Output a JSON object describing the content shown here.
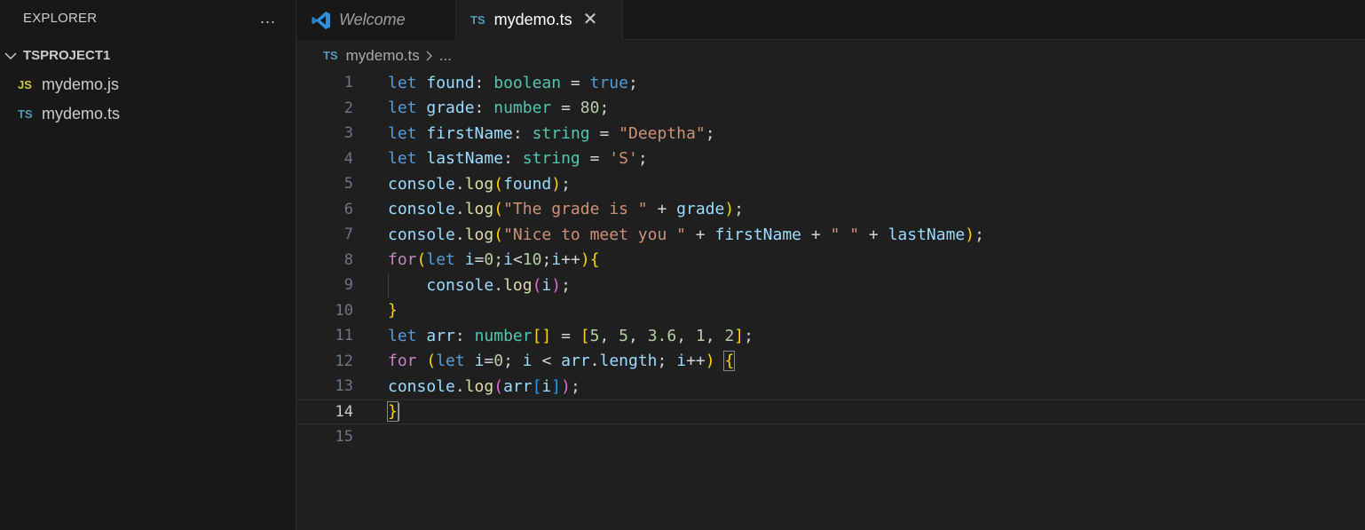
{
  "sidebar": {
    "title": "EXPLORER",
    "more_icon": "...",
    "folder": "TSPROJECT1",
    "files": [
      {
        "badge": "JS",
        "name": "mydemo.js"
      },
      {
        "badge": "TS",
        "name": "mydemo.ts"
      }
    ]
  },
  "tabs": [
    {
      "label": "Welcome",
      "icon": "vscode-logo-icon"
    },
    {
      "badge": "TS",
      "label": "mydemo.ts",
      "close": "✕"
    }
  ],
  "breadcrumb": {
    "badge": "TS",
    "file": "mydemo.ts",
    "rest": "..."
  },
  "editor": {
    "current_line": 14,
    "lines": [
      {
        "n": "1"
      },
      {
        "n": "2"
      },
      {
        "n": "3"
      },
      {
        "n": "4"
      },
      {
        "n": "5"
      },
      {
        "n": "6"
      },
      {
        "n": "7"
      },
      {
        "n": "8"
      },
      {
        "n": "9"
      },
      {
        "n": "10"
      },
      {
        "n": "11"
      },
      {
        "n": "12"
      },
      {
        "n": "13"
      },
      {
        "n": "14"
      },
      {
        "n": "15"
      }
    ],
    "tokens": {
      "let": "let",
      "for": "for",
      "found": "found",
      "grade": "grade",
      "firstName": "firstName",
      "lastName": "lastName",
      "arr": "arr",
      "i": "i",
      "boolean": "boolean",
      "number": "number",
      "string": "string",
      "true": "true",
      "n80": "80",
      "deeptha": "\"Deeptha\"",
      "s_S": "'S'",
      "console": "console",
      "log": "log",
      "grade_str": "\"The grade is \"",
      "nice_str": "\"Nice to meet you \"",
      "space_str": "\" \"",
      "length": "length",
      "zero": "0",
      "ten": "10",
      "five": "5",
      "three6": "3.6",
      "one": "1",
      "two": "2"
    }
  },
  "colors": {
    "keyword": "#569cd6",
    "control": "#c586c0",
    "variable": "#9cdcfe",
    "type": "#4ec9b0",
    "string": "#ce9178",
    "number": "#b5cea8",
    "function": "#dcdcaa",
    "bracket1": "#ffd700",
    "bracket2": "#da70d6",
    "bracket3": "#179fff"
  }
}
